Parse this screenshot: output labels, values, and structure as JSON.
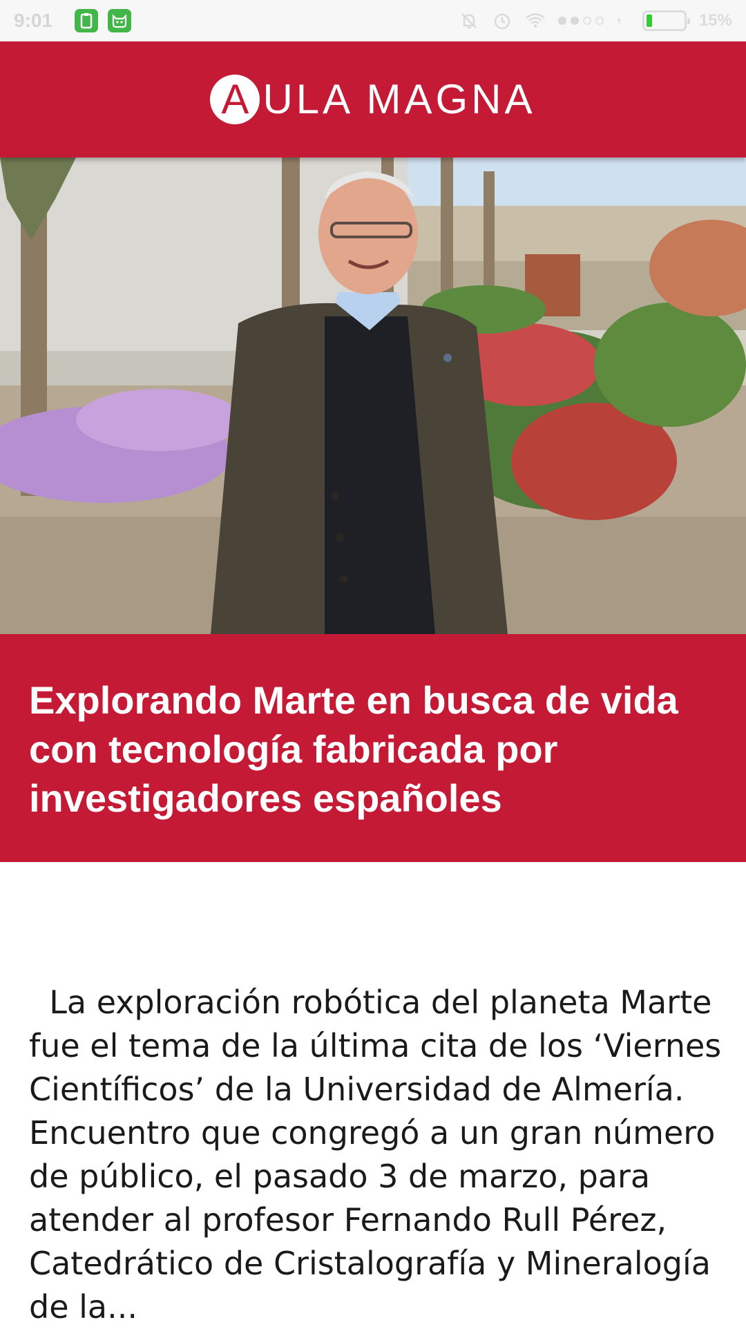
{
  "status_bar": {
    "time": "9:01",
    "notification_icons": [
      "clipboard-icon",
      "cat-app-icon"
    ],
    "indicator_icons": [
      "alarm-off-icon",
      "alarm-clock-icon",
      "wifi-icon",
      "signal-icon",
      "charging-icon"
    ],
    "battery_level": 0.15,
    "battery_text": "15%"
  },
  "header": {
    "logo_letter": "A",
    "logo_rest": "ULA MAGNA"
  },
  "hero": {
    "image": "man-in-garden-photo"
  },
  "article": {
    "title": "Explorando Marte en busca de vida con tecnología fabricada por investigadores españoles",
    "excerpt": "  La exploración robótica del planeta Marte fue el tema de la última cita de los ‘Viernes Científicos’ de la Universidad de Almería. Encuentro que congregó a un gran número de público, el pasado 3 de marzo, para atender al profesor Fernando Rull Pérez, Catedrático de Cristalografía y Mineralogía de la..."
  },
  "colors": {
    "brand": "#c41a35",
    "status_bar": "#f7f7f7",
    "notification_green": "#43b649",
    "text": "#1a1a1a"
  }
}
